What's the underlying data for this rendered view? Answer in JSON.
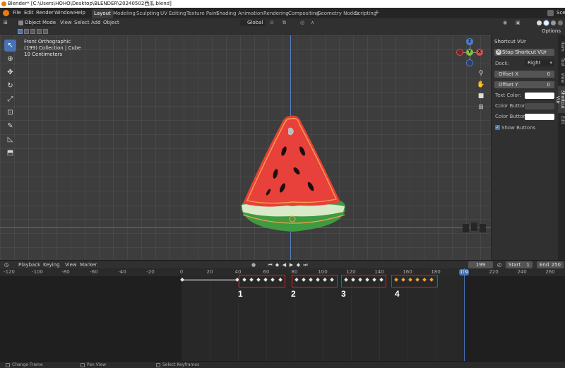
{
  "window": {
    "title": "Blender* [C:\\Users\\HOHO\\Desktop\\BLENDER\\20240502西瓜.blend]"
  },
  "menu": [
    "File",
    "Edit",
    "Render",
    "Window",
    "Help"
  ],
  "workspaces": [
    "Layout",
    "Modeling",
    "Sculpting",
    "UV Editing",
    "Texture Paint",
    "Shading",
    "Animation",
    "Rendering",
    "Compositing",
    "Geometry Nodes",
    "Scripting"
  ],
  "active_workspace": "Layout",
  "scene_label": "Sce",
  "viewport_header": {
    "mode": "Object Mode",
    "menus": [
      "View",
      "Select",
      "Add",
      "Object"
    ],
    "transform_orientation": "Global",
    "options": "Options"
  },
  "viewport_info": {
    "line1": "Front Orthographic",
    "line2": "(199) Collection | Cube",
    "line3": "10 Centimeters"
  },
  "gizmo": {
    "x": "X",
    "y": "Y",
    "z": "Z"
  },
  "sidebar": {
    "title": "Shortcut VUr",
    "stop_button": "Stop Shortcut VUr",
    "dock_label": "Dock:",
    "dock_value": "Right",
    "offset_x_label": "Offset X",
    "offset_x_value": "0",
    "offset_y_label": "Offset Y",
    "offset_y_value": "0",
    "text_color_label": "Text Color:",
    "color_buttons_label": "Color Buttons:",
    "color_buttons_a_label": "Color Buttons a..",
    "show_buttons_label": "Show Buttons",
    "tabs": [
      "Item",
      "Tool",
      "View",
      "Shortcut VUr",
      "Edit"
    ],
    "colors": {
      "text_color": "#ffffff",
      "color_buttons": "#4a4a4a",
      "color_buttons_a": "#ffffff"
    }
  },
  "timeline": {
    "menus": [
      "Playback",
      "Keying",
      "View",
      "Marker"
    ],
    "current_frame": "199",
    "start_label": "Start",
    "start_value": "1",
    "end_label": "End",
    "end_value": "250",
    "ruler_ticks": [
      "-120",
      "-100",
      "-80",
      "-60",
      "-40",
      "-20",
      "0",
      "20",
      "40",
      "60",
      "80",
      "100",
      "120",
      "140",
      "160",
      "180",
      "220",
      "240",
      "260"
    ],
    "group_labels": [
      "1",
      "2",
      "3",
      "4"
    ]
  },
  "statusbar": [
    "Change Frame",
    "Pan View",
    "Select Keyframes"
  ],
  "colors": {
    "accent": "#4772b3",
    "watermelon_red": "#e8403a",
    "rind_green": "#3f9a40",
    "highlight": "#e02020"
  }
}
